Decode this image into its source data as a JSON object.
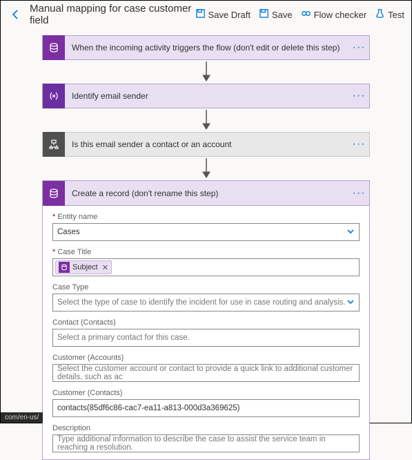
{
  "header": {
    "title": "Manual mapping for case customer field",
    "buttons": {
      "save_draft": "Save Draft",
      "save": "Save",
      "flow_checker": "Flow checker",
      "test": "Test"
    }
  },
  "steps": {
    "s1": "When the incoming activity triggers the flow (don't edit or delete this step)",
    "s2": "Identify email sender",
    "s3": "Is this email sender a contact or an account",
    "s4": "Create a record (don't rename this step)"
  },
  "fields": {
    "entity_name": {
      "label": "Entity name",
      "value": "Cases"
    },
    "case_title": {
      "label": "Case Title",
      "chip": "Subject"
    },
    "case_type": {
      "label": "Case Type",
      "placeholder": "Select the type of case to identify the incident for use in case routing and analysis."
    },
    "contact": {
      "label": "Contact (Contacts)",
      "placeholder": "Select a primary contact for this case."
    },
    "customer_acc": {
      "label": "Customer (Accounts)",
      "placeholder": "Select the customer account or contact to provide a quick link to additional customer details, such as ac"
    },
    "customer_con": {
      "label": "Customer (Contacts)",
      "value": "contacts(85df6c86-cac7-ea11-a813-000d3a369625)"
    },
    "description": {
      "label": "Description",
      "placeholder": "Type additional information to describe the case to assist the service team in reaching a resolution."
    }
  },
  "status": "com/en-us/"
}
